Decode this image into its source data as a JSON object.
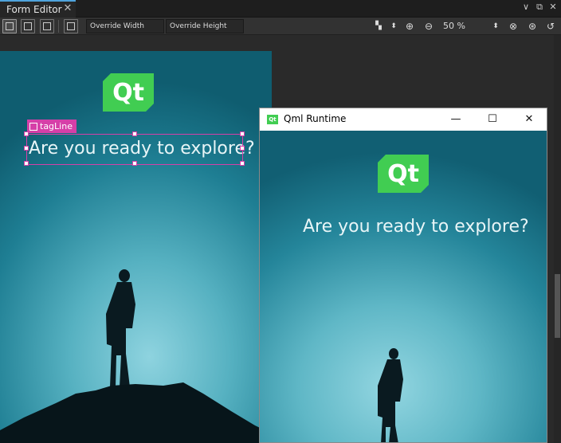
{
  "tab": {
    "title": "Form Editor",
    "close": "✕"
  },
  "window_controls": {
    "dropdown": "∨",
    "float": "⧉",
    "close": "✕"
  },
  "toolbar": {
    "override_width": "Override Width",
    "override_height": "Override Height",
    "zoom": "50 %"
  },
  "scene": {
    "logo_text": "Qt",
    "tagline": "Are you ready to explore?"
  },
  "selection": {
    "id": "tagLine"
  },
  "qml_runtime": {
    "title": "Qml Runtime",
    "minimize": "—",
    "maximize": "☐",
    "close": "✕",
    "logo_text": "Qt",
    "tagline": "Are you ready to explore?"
  },
  "colors": {
    "accent": "#4fa3dc",
    "selection": "#d63fa8",
    "qt_green": "#41cd52"
  }
}
